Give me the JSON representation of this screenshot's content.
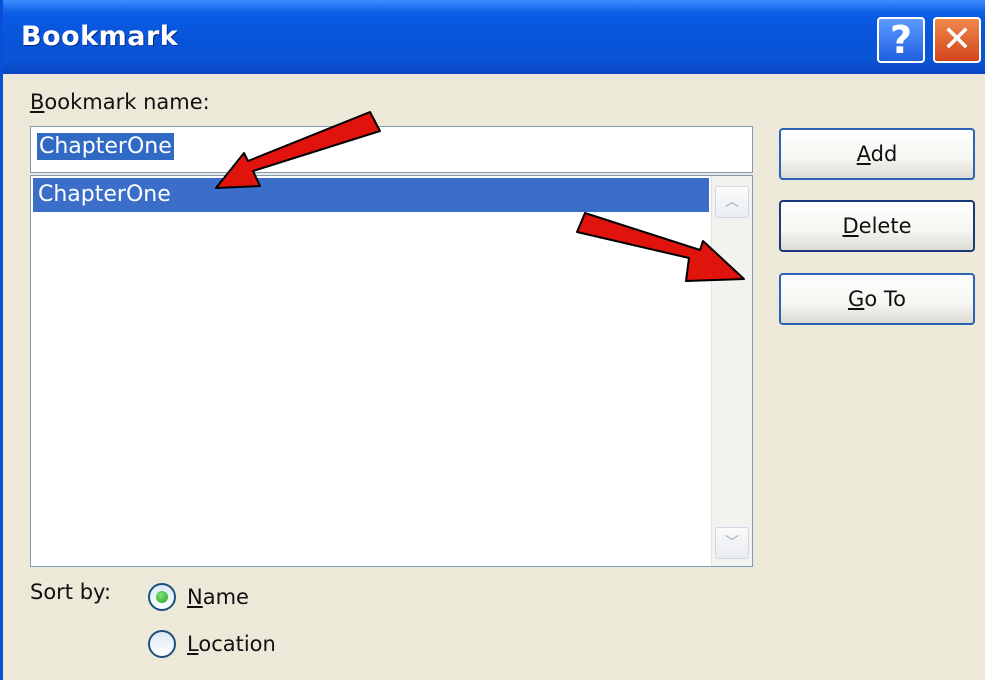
{
  "window": {
    "title": "Bookmark",
    "help_glyph": "?",
    "close_glyph": "✕"
  },
  "name_field": {
    "label_accel": "B",
    "label_rest": "ookmark name:",
    "value": "ChapterOne"
  },
  "list": {
    "items": [
      {
        "label": "ChapterOne",
        "selected": true
      }
    ],
    "scroll_up_glyph": "︿",
    "scroll_down_glyph": "﹀"
  },
  "buttons": {
    "add": {
      "accel": "A",
      "rest": "dd"
    },
    "delete": {
      "accel": "D",
      "rest": "elete"
    },
    "goto": {
      "accel": "G",
      "rest": "o To"
    }
  },
  "sort": {
    "label": "Sort by:",
    "options": [
      {
        "accel": "N",
        "rest": "ame",
        "selected": true
      },
      {
        "accel": "L",
        "rest": "ocation",
        "selected": false
      }
    ]
  },
  "colors": {
    "titlebar": "#0754d8",
    "selection": "#316ac5",
    "arrow": "#e0140c"
  }
}
